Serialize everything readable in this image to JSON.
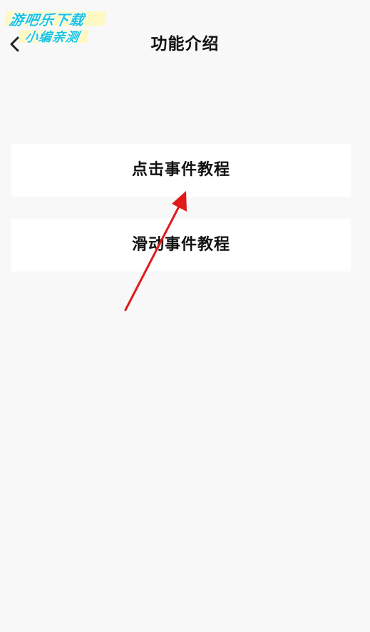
{
  "watermark": {
    "line1": "游吧乐下载",
    "line2": "小编亲测"
  },
  "header": {
    "back_icon": "chevron-left-icon",
    "title": "功能介绍"
  },
  "menu": {
    "items": [
      {
        "label": "点击事件教程"
      },
      {
        "label": "滑动事件教程"
      }
    ]
  },
  "colors": {
    "background": "#f8f8f8",
    "card": "#ffffff",
    "text": "#111111",
    "watermark": "#1ec3e0",
    "annotation_arrow": "#e01a1a"
  }
}
